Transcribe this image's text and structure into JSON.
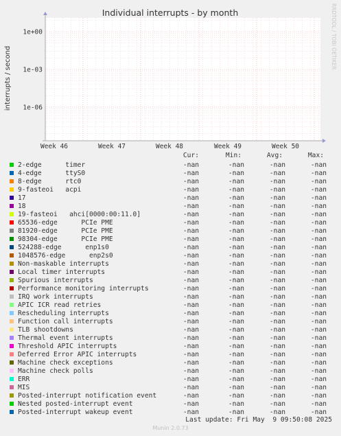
{
  "chart_data": {
    "type": "line",
    "title": "Individual interrupts - by month",
    "ylabel": "interrupts / second",
    "xlabel": "",
    "y_scale": "log",
    "y_ticks": [
      "1e+00",
      "1e-03",
      "1e-06"
    ],
    "x_ticks": [
      "Week 46",
      "Week 47",
      "Week 48",
      "Week 49",
      "Week 50"
    ],
    "grid": true,
    "series": []
  },
  "watermark": "RRDTOOL / TOBI OETIKER",
  "legend_header": {
    "cur": "Cur:",
    "min": "Min:",
    "avg": "Avg:",
    "max": "Max:"
  },
  "legend": [
    {
      "name": "2-edge      timer",
      "color": "#00cc00",
      "cur": "-nan",
      "min": "-nan",
      "avg": "-nan",
      "max": "-nan"
    },
    {
      "name": "4-edge      ttyS0",
      "color": "#0066b3",
      "cur": "-nan",
      "min": "-nan",
      "avg": "-nan",
      "max": "-nan"
    },
    {
      "name": "8-edge      rtc0",
      "color": "#ff8000",
      "cur": "-nan",
      "min": "-nan",
      "avg": "-nan",
      "max": "-nan"
    },
    {
      "name": "9-fasteoi   acpi",
      "color": "#ffcc00",
      "cur": "-nan",
      "min": "-nan",
      "avg": "-nan",
      "max": "-nan"
    },
    {
      "name": "17",
      "color": "#330099",
      "cur": "-nan",
      "min": "-nan",
      "avg": "-nan",
      "max": "-nan"
    },
    {
      "name": "18",
      "color": "#990099",
      "cur": "-nan",
      "min": "-nan",
      "avg": "-nan",
      "max": "-nan"
    },
    {
      "name": "19-fasteoi   ahci[0000:00:11.0]",
      "color": "#ccff00",
      "cur": "-nan",
      "min": "-nan",
      "avg": "-nan",
      "max": "-nan"
    },
    {
      "name": "65536-edge      PCIe PME",
      "color": "#ff0000",
      "cur": "-nan",
      "min": "-nan",
      "avg": "-nan",
      "max": "-nan"
    },
    {
      "name": "81920-edge      PCIe PME",
      "color": "#808080",
      "cur": "-nan",
      "min": "-nan",
      "avg": "-nan",
      "max": "-nan"
    },
    {
      "name": "98304-edge      PCIe PME",
      "color": "#008f00",
      "cur": "-nan",
      "min": "-nan",
      "avg": "-nan",
      "max": "-nan"
    },
    {
      "name": "524288-edge      enp1s0",
      "color": "#00487d",
      "cur": "-nan",
      "min": "-nan",
      "avg": "-nan",
      "max": "-nan"
    },
    {
      "name": "1048576-edge      enp2s0",
      "color": "#b35a00",
      "cur": "-nan",
      "min": "-nan",
      "avg": "-nan",
      "max": "-nan"
    },
    {
      "name": "Non-maskable interrupts",
      "color": "#b38f00",
      "cur": "-nan",
      "min": "-nan",
      "avg": "-nan",
      "max": "-nan"
    },
    {
      "name": "Local timer interrupts",
      "color": "#6b006b",
      "cur": "-nan",
      "min": "-nan",
      "avg": "-nan",
      "max": "-nan"
    },
    {
      "name": "Spurious interrupts",
      "color": "#8fb300",
      "cur": "-nan",
      "min": "-nan",
      "avg": "-nan",
      "max": "-nan"
    },
    {
      "name": "Performance monitoring interrupts",
      "color": "#b30000",
      "cur": "-nan",
      "min": "-nan",
      "avg": "-nan",
      "max": "-nan"
    },
    {
      "name": "IRQ work interrupts",
      "color": "#bebebe",
      "cur": "-nan",
      "min": "-nan",
      "avg": "-nan",
      "max": "-nan"
    },
    {
      "name": "APIC ICR read retries",
      "color": "#80ff80",
      "cur": "-nan",
      "min": "-nan",
      "avg": "-nan",
      "max": "-nan"
    },
    {
      "name": "Rescheduling interrupts",
      "color": "#80c9ff",
      "cur": "-nan",
      "min": "-nan",
      "avg": "-nan",
      "max": "-nan"
    },
    {
      "name": "Function call interrupts",
      "color": "#ffc080",
      "cur": "-nan",
      "min": "-nan",
      "avg": "-nan",
      "max": "-nan"
    },
    {
      "name": "TLB shootdowns",
      "color": "#ffe680",
      "cur": "-nan",
      "min": "-nan",
      "avg": "-nan",
      "max": "-nan"
    },
    {
      "name": "Thermal event interrupts",
      "color": "#aa80ff",
      "cur": "-nan",
      "min": "-nan",
      "avg": "-nan",
      "max": "-nan"
    },
    {
      "name": "Threshold APIC interrupts",
      "color": "#ee00cc",
      "cur": "-nan",
      "min": "-nan",
      "avg": "-nan",
      "max": "-nan"
    },
    {
      "name": "Deferred Error APIC interrupts",
      "color": "#ff8080",
      "cur": "-nan",
      "min": "-nan",
      "avg": "-nan",
      "max": "-nan"
    },
    {
      "name": "Machine check exceptions",
      "color": "#666600",
      "cur": "-nan",
      "min": "-nan",
      "avg": "-nan",
      "max": "-nan"
    },
    {
      "name": "Machine check polls",
      "color": "#ffbfff",
      "cur": "-nan",
      "min": "-nan",
      "avg": "-nan",
      "max": "-nan"
    },
    {
      "name": "ERR",
      "color": "#00ffcc",
      "cur": "-nan",
      "min": "-nan",
      "avg": "-nan",
      "max": "-nan"
    },
    {
      "name": "MIS",
      "color": "#cc6699",
      "cur": "-nan",
      "min": "-nan",
      "avg": "-nan",
      "max": "-nan"
    },
    {
      "name": "Posted-interrupt notification event",
      "color": "#999900",
      "cur": "-nan",
      "min": "-nan",
      "avg": "-nan",
      "max": "-nan"
    },
    {
      "name": "Nested posted-interrupt event",
      "color": "#00cc00",
      "cur": "-nan",
      "min": "-nan",
      "avg": "-nan",
      "max": "-nan"
    },
    {
      "name": "Posted-interrupt wakeup event",
      "color": "#0066b3",
      "cur": "-nan",
      "min": "-nan",
      "avg": "-nan",
      "max": "-nan"
    }
  ],
  "last_update": "Last update: Fri May  9 09:50:08 2025",
  "footer": "Munin 2.0.73"
}
